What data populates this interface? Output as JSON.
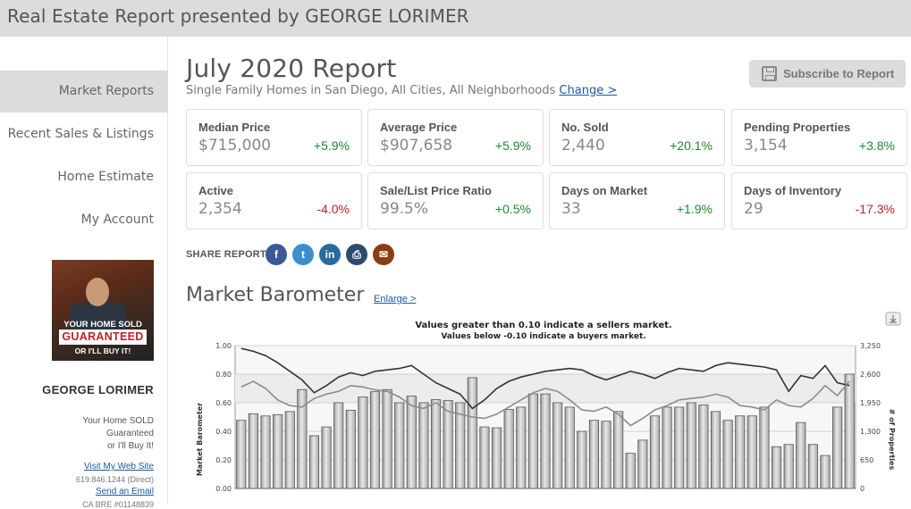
{
  "header": {
    "title": "Real Estate Report presented by GEORGE LORIMER"
  },
  "sidebar": {
    "nav": [
      {
        "label": "Market Reports",
        "active": true
      },
      {
        "label": "Recent Sales & Listings",
        "active": false
      },
      {
        "label": "Home Estimate",
        "active": false
      },
      {
        "label": "My Account",
        "active": false
      }
    ],
    "agent_banner": {
      "line1": "YOUR HOME SOLD",
      "line2": "GUARANTEED",
      "line3": "OR I'LL BUY IT!"
    },
    "agent_name": "GEORGE LORIMER",
    "tagline": [
      "Your Home SOLD",
      "Guaranteed",
      "or I'll Buy It!"
    ],
    "visit_site": "Visit My Web Site",
    "phone": "619.846.1244 (Direct)",
    "send_email": "Send an Email",
    "license": "CA BRE #01148839"
  },
  "report": {
    "title": "July 2020 Report",
    "subtitle": "Single Family Homes in San Diego, All Cities, All Neighborhoods",
    "change_link": "Change >",
    "subscribe_label": "Subscribe to Report"
  },
  "stats": [
    {
      "label": "Median Price",
      "value": "$715,000",
      "change": "+5.9%",
      "direction": "up"
    },
    {
      "label": "Average Price",
      "value": "$907,658",
      "change": "+5.9%",
      "direction": "up"
    },
    {
      "label": "No. Sold",
      "value": "2,440",
      "change": "+20.1%",
      "direction": "up"
    },
    {
      "label": "Pending Properties",
      "value": "3,154",
      "change": "+3.8%",
      "direction": "up"
    },
    {
      "label": "Active",
      "value": "2,354",
      "change": "-4.0%",
      "direction": "down"
    },
    {
      "label": "Sale/List Price Ratio",
      "value": "99.5%",
      "change": "+0.5%",
      "direction": "up"
    },
    {
      "label": "Days on Market",
      "value": "33",
      "change": "+1.9%",
      "direction": "up"
    },
    {
      "label": "Days of Inventory",
      "value": "29",
      "change": "-17.3%",
      "direction": "down"
    }
  ],
  "share": {
    "label": "SHARE REPORT",
    "buttons": [
      {
        "name": "facebook-icon",
        "glyph": "f",
        "color": "#3b5998"
      },
      {
        "name": "twitter-icon",
        "glyph": "t",
        "color": "#3b8fd0"
      },
      {
        "name": "linkedin-icon",
        "glyph": "in",
        "color": "#2a6aa0"
      },
      {
        "name": "print-icon",
        "glyph": "⎙",
        "color": "#2e4a70"
      },
      {
        "name": "email-icon",
        "glyph": "✉",
        "color": "#8a3d10"
      }
    ]
  },
  "barometer": {
    "title": "Market Barometer",
    "enlarge_link": "Enlarge >"
  },
  "chart_data": {
    "type": "bar",
    "notes": [
      "Values greater than 0.10 indicate a sellers market.",
      "Values below -0.10 indicate a buyers market."
    ],
    "ylabel": "Market Barometer",
    "y2label": "# of Properties",
    "ylim": [
      0,
      1.0
    ],
    "yticks": [
      "0.00",
      "0.20",
      "0.40",
      "0.60",
      "0.80",
      "1.00"
    ],
    "y2lim": [
      0,
      3250
    ],
    "y2ticks": [
      "0",
      "650",
      "1,300",
      "1,950",
      "2,600",
      "3,250"
    ],
    "grid": true,
    "bars": [
      1550,
      1700,
      1650,
      1680,
      1750,
      2250,
      1200,
      1400,
      1950,
      1780,
      2080,
      2200,
      2250,
      1950,
      2100,
      1950,
      2020,
      2000,
      1950,
      2520,
      1400,
      1380,
      1800,
      1850,
      2150,
      2150,
      1950,
      1850,
      1300,
      1550,
      1530,
      1750,
      800,
      1100,
      1650,
      1850,
      1850,
      1950,
      1900,
      1750,
      1550,
      1650,
      1650,
      1850,
      950,
      1000,
      1500,
      1000,
      750,
      1850,
      2600
    ],
    "series": [
      {
        "line": "dark",
        "values": [
          0.98,
          0.96,
          0.93,
          0.88,
          0.82,
          0.76,
          0.67,
          0.72,
          0.78,
          0.81,
          0.79,
          0.82,
          0.83,
          0.84,
          0.86,
          0.8,
          0.74,
          0.7,
          0.66,
          0.56,
          0.62,
          0.7,
          0.75,
          0.78,
          0.8,
          0.82,
          0.83,
          0.84,
          0.83,
          0.79,
          0.76,
          0.79,
          0.82,
          0.8,
          0.77,
          0.81,
          0.84,
          0.83,
          0.82,
          0.86,
          0.88,
          0.87,
          0.86,
          0.85,
          0.83,
          0.68,
          0.79,
          0.77,
          0.86,
          0.74,
          0.72
        ]
      },
      {
        "line": "light",
        "values": [
          0.71,
          0.75,
          0.7,
          0.62,
          0.58,
          0.57,
          0.63,
          0.66,
          0.68,
          0.72,
          0.71,
          0.69,
          0.68,
          0.64,
          0.58,
          0.56,
          0.6,
          0.54,
          0.52,
          0.5,
          0.49,
          0.52,
          0.57,
          0.62,
          0.67,
          0.7,
          0.68,
          0.62,
          0.55,
          0.54,
          0.57,
          0.52,
          0.44,
          0.49,
          0.55,
          0.58,
          0.62,
          0.63,
          0.64,
          0.66,
          0.64,
          0.58,
          0.57,
          0.55,
          0.62,
          0.58,
          0.57,
          0.63,
          0.72,
          0.65,
          0.75
        ]
      }
    ]
  }
}
